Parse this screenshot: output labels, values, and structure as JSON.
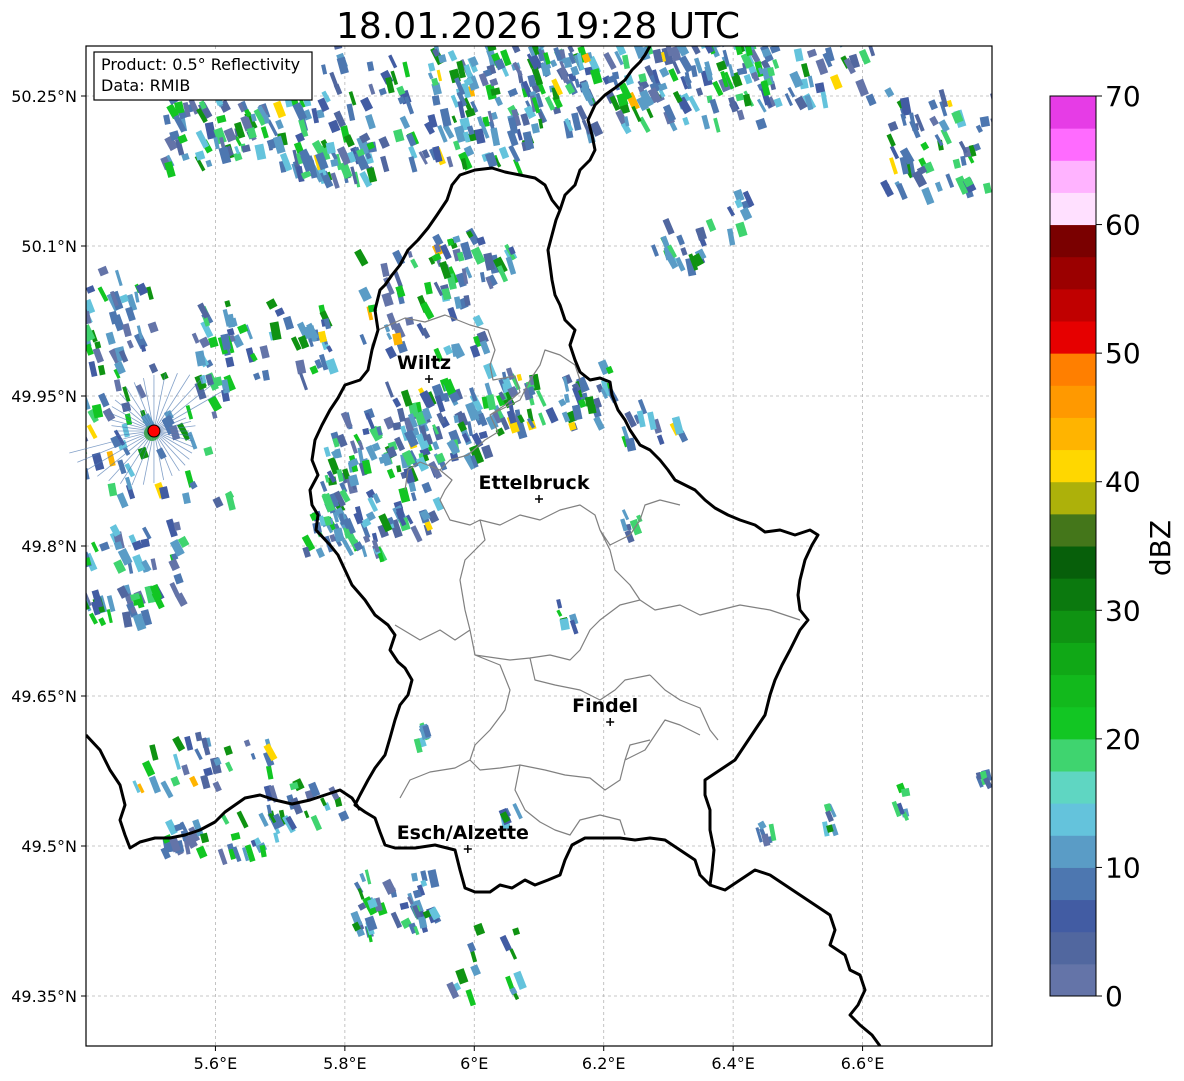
{
  "title": "18.01.2026 19:28 UTC",
  "info_box": {
    "line1": "Product: 0.5° Reflectivity",
    "line2": "Data: RMIB"
  },
  "axes": {
    "lon_ticks": [
      {
        "value": 5.6,
        "label": "5.6°E"
      },
      {
        "value": 5.8,
        "label": "5.8°E"
      },
      {
        "value": 6.0,
        "label": "6°E"
      },
      {
        "value": 6.2,
        "label": "6.2°E"
      },
      {
        "value": 6.4,
        "label": "6.4°E"
      },
      {
        "value": 6.6,
        "label": "6.6°E"
      }
    ],
    "lat_ticks": [
      {
        "value": 50.25,
        "label": "50.25°N"
      },
      {
        "value": 50.1,
        "label": "50.1°N"
      },
      {
        "value": 49.95,
        "label": "49.95°N"
      },
      {
        "value": 49.8,
        "label": "49.8°N"
      },
      {
        "value": 49.65,
        "label": "49.65°N"
      },
      {
        "value": 49.5,
        "label": "49.5°N"
      },
      {
        "value": 49.35,
        "label": "49.35°N"
      }
    ],
    "lon_range": [
      5.4,
      6.8
    ],
    "lat_range": [
      49.3,
      50.3
    ],
    "grid": true
  },
  "cities": [
    {
      "name": "Wiltz",
      "lon": 5.93,
      "lat": 49.967
    },
    {
      "name": "Ettelbruck",
      "lon": 6.1,
      "lat": 49.847
    },
    {
      "name": "Findel",
      "lon": 6.21,
      "lat": 49.624
    },
    {
      "name": "Esch/Alzette",
      "lon": 5.99,
      "lat": 49.497
    }
  ],
  "radar_site": {
    "lon": 5.505,
    "lat": 49.915,
    "color": "#ff0000"
  },
  "colorbar": {
    "label": "dBZ",
    "min": 0,
    "max": 70,
    "step": 2.5,
    "tick_labels": [
      "0",
      "10",
      "20",
      "30",
      "40",
      "50",
      "60",
      "70"
    ],
    "colors": [
      "#6474a8",
      "#51679f",
      "#425ca3",
      "#4d77b0",
      "#5a9cc6",
      "#64c3dc",
      "#5fd6c2",
      "#3fd46f",
      "#12c623",
      "#12b91c",
      "#10a816",
      "#0f9312",
      "#0b790e",
      "#075f0a",
      "#44761a",
      "#adb10a",
      "#ffd700",
      "#ffb400",
      "#ff9900",
      "#ff7f00",
      "#e60000",
      "#c00000",
      "#9b0000",
      "#7a0000",
      "#ffe0ff",
      "#ffb3ff",
      "#ff6bff",
      "#e63ce6"
    ]
  }
}
